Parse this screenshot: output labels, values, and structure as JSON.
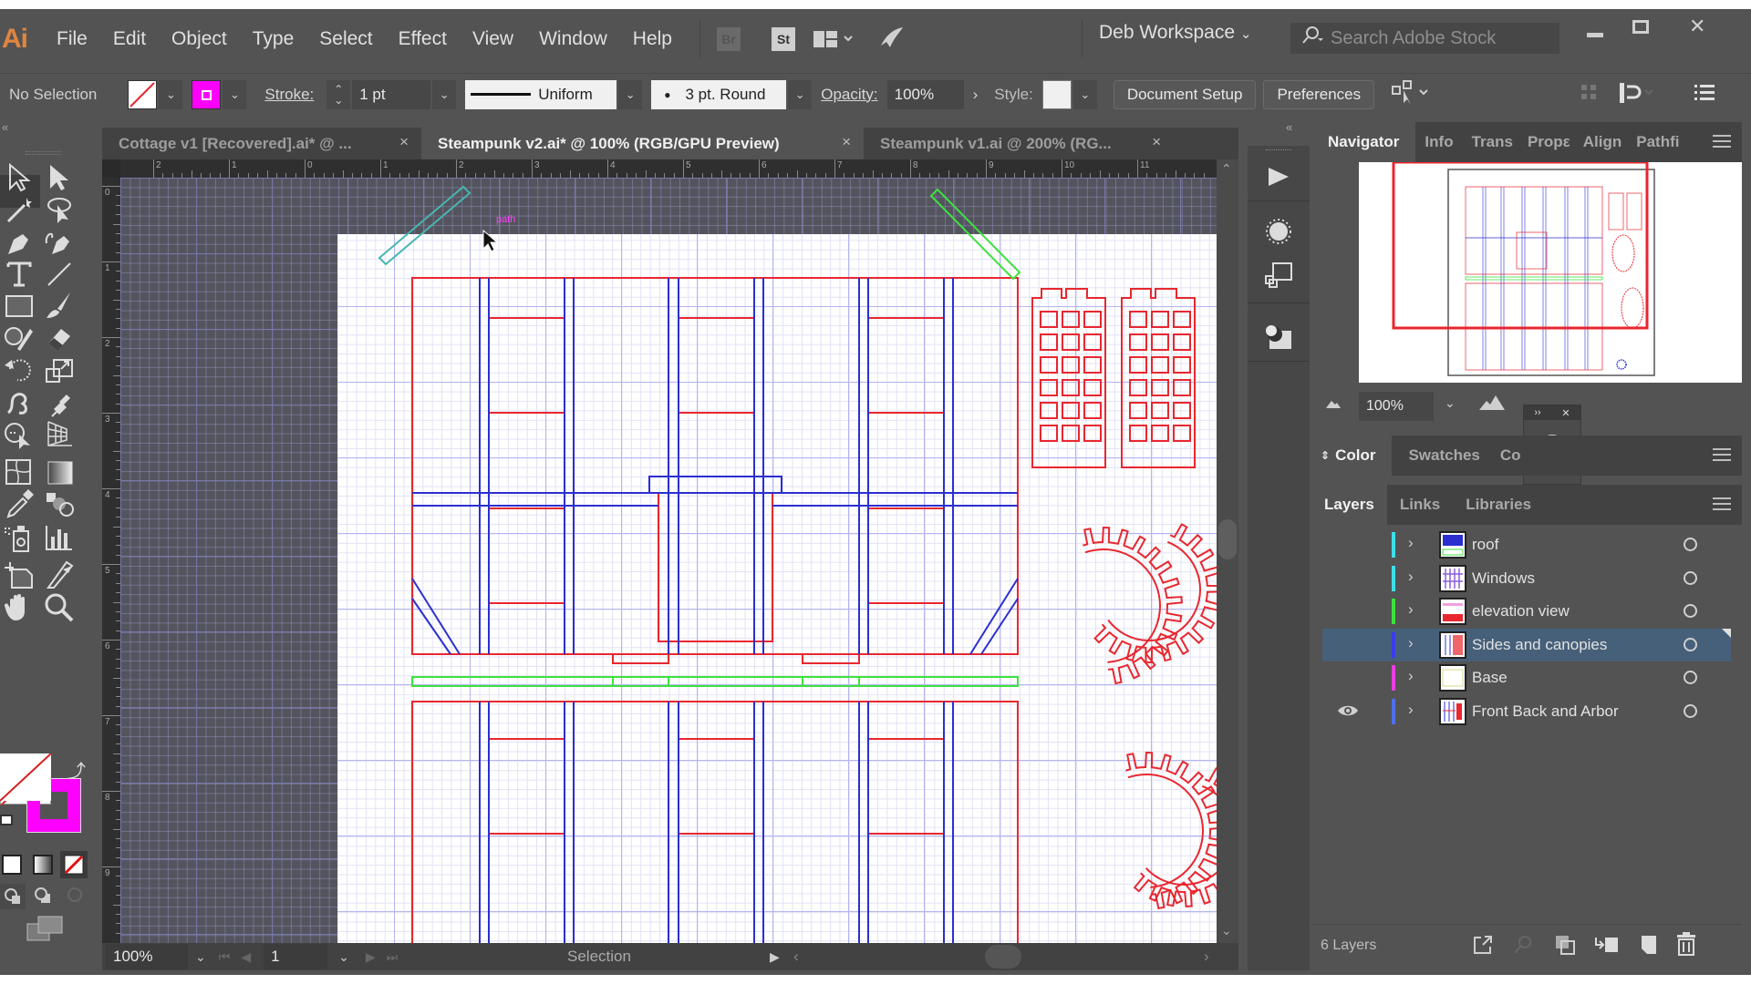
{
  "app": {
    "logo": "Ai",
    "menu": [
      "File",
      "Edit",
      "Object",
      "Type",
      "Select",
      "Effect",
      "View",
      "Window",
      "Help"
    ],
    "bridge_label": "Br",
    "stock_label": "St",
    "workspace": "Deb Workspace",
    "search_placeholder": "Search Adobe Stock",
    "window_controls": {
      "minimize": "–",
      "maximize": "□",
      "close": "✕"
    }
  },
  "control_bar": {
    "selection_label": "No Selection",
    "fill": "none",
    "stroke_color": "#ff00ff",
    "stroke_label": "Stroke:",
    "stroke_weight": "1 pt",
    "stroke_profile": "Uniform",
    "brush": "3 pt. Round",
    "opacity_label": "Opacity:",
    "opacity": "100%",
    "style_label": "Style:",
    "document_setup": "Document Setup",
    "preferences": "Preferences"
  },
  "tabs": [
    {
      "label": "Cottage v1 [Recovered].ai* @ ...",
      "active": false
    },
    {
      "label": "Steampunk v2.ai* @ 100% (RGB/GPU Preview)",
      "active": true
    },
    {
      "label": "Steampunk v1.ai @ 200% (RG...",
      "active": false
    }
  ],
  "rulers": {
    "horizontal": [
      "2",
      "1",
      "0",
      "1",
      "2",
      "3",
      "4",
      "5",
      "6",
      "7",
      "8",
      "9",
      "10",
      "11"
    ],
    "vertical": [
      "0",
      "1",
      "2",
      "3",
      "4",
      "5",
      "6",
      "7",
      "8",
      "9"
    ]
  },
  "canvas": {
    "hover_label": "path",
    "colors": {
      "red": "#e8272f",
      "blue": "#2b2fd0",
      "green": "#3ee23e",
      "teal": "#49b5b0"
    }
  },
  "toolbar": {
    "tools": [
      "selection-tool",
      "direct-selection-tool",
      "magic-wand-tool",
      "lasso-tool",
      "pen-tool",
      "curvature-tool",
      "type-tool",
      "line-segment-tool",
      "rectangle-tool",
      "paintbrush-tool",
      "shaper-tool",
      "eraser-tool",
      "rotate-tool",
      "scale-tool",
      "warp-tool",
      "puppet-warp-tool",
      "shape-builder-tool",
      "perspective-grid-tool",
      "mesh-tool",
      "gradient-tool",
      "eyedropper-tool",
      "blend-tool",
      "symbol-sprayer-tool",
      "column-graph-tool",
      "artboard-tool",
      "slice-tool",
      "hand-tool",
      "zoom-tool"
    ],
    "fill": "none",
    "stroke": "#ff00ff"
  },
  "status_bar": {
    "zoom": "100%",
    "artboard_number": "1",
    "tool_name": "Selection"
  },
  "navigator": {
    "tabs": [
      "Navigator",
      "Info",
      "Trans",
      "Propε",
      "Align",
      "Pathfi"
    ],
    "zoom": "100%"
  },
  "color_panel": {
    "tabs": [
      "Color",
      "Swatches",
      "Co"
    ]
  },
  "layers_panel": {
    "tabs": [
      "Layers",
      "Links",
      "Libraries"
    ],
    "layers": [
      {
        "name": "roof",
        "color": "#3de0e8",
        "visible": false,
        "selected": false
      },
      {
        "name": "Windows",
        "color": "#3de0e8",
        "visible": false,
        "selected": false
      },
      {
        "name": "elevation view",
        "color": "#3ee23e",
        "visible": false,
        "selected": false
      },
      {
        "name": "Sides and canopies",
        "color": "#3b3bea",
        "visible": false,
        "selected": true
      },
      {
        "name": "Base",
        "color": "#e83ee0",
        "visible": false,
        "selected": false
      },
      {
        "name": "Front Back and Arbor",
        "color": "#4f6fe8",
        "visible": true,
        "selected": false
      }
    ],
    "count_label": "6 Layers"
  }
}
